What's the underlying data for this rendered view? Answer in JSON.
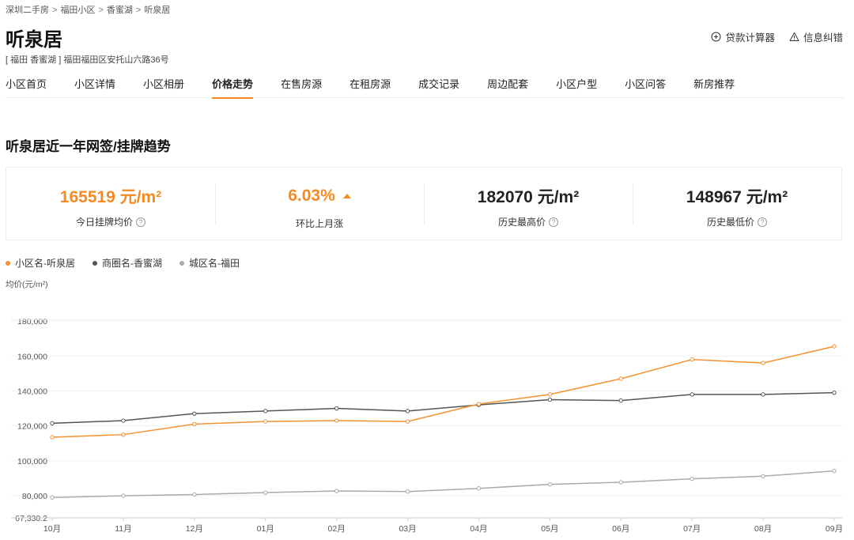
{
  "breadcrumb": [
    "深圳二手房",
    "福田小区",
    "香蜜湖",
    "听泉居"
  ],
  "breadcrumb_sep": ">",
  "title": "听泉居",
  "address": "[ 福田 香蜜湖 ] 福田福田区安托山六路36号",
  "tools": {
    "calculator": "贷款计算器",
    "report": "信息纠错"
  },
  "nav": [
    "小区首页",
    "小区详情",
    "小区相册",
    "价格走势",
    "在售房源",
    "在租房源",
    "成交记录",
    "周边配套",
    "小区户型",
    "小区问答",
    "新房推荐"
  ],
  "nav_active": 3,
  "section_title": "听泉居近一年网签/挂牌趋势",
  "stats": [
    {
      "value": "165519 元/m²",
      "label": "今日挂牌均价"
    },
    {
      "value": "6.03%",
      "label": "环比上月涨"
    },
    {
      "value": "182070 元/m²",
      "label": "历史最高价"
    },
    {
      "value": "148967 元/m²",
      "label": "历史最低价"
    }
  ],
  "colors": {
    "accent": "#f58a23",
    "community": "#f5912e",
    "district": "#555555",
    "city": "#aaaaaa"
  },
  "chart_data": {
    "type": "line",
    "ylabel": "均价(元/m²)",
    "categories": [
      "10月",
      "11月",
      "12月",
      "01月",
      "02月",
      "03月",
      "04月",
      "05月",
      "06月",
      "07月",
      "08月",
      "09月"
    ],
    "y_ticks": [
      "67,330.2",
      "80,000",
      "100,000",
      "120,000",
      "140,000",
      "160,000",
      "180,000"
    ],
    "ylim": [
      67330.2,
      190000
    ],
    "grid": true,
    "legend_position": "top-left",
    "series": [
      {
        "name": "小区名-听泉居",
        "values": [
          113500,
          115000,
          121000,
          122500,
          123000,
          122500,
          132500,
          138000,
          147000,
          158000,
          156000,
          165519
        ]
      },
      {
        "name": "商圈名-香蜜湖",
        "values": [
          121500,
          123000,
          127000,
          128500,
          130000,
          128500,
          132000,
          135000,
          134500,
          138000,
          138000,
          139000
        ]
      },
      {
        "name": "城区名-福田",
        "values": [
          79000,
          80000,
          80700,
          81800,
          82700,
          82400,
          84200,
          86500,
          87700,
          89700,
          91200,
          94200
        ]
      }
    ]
  }
}
